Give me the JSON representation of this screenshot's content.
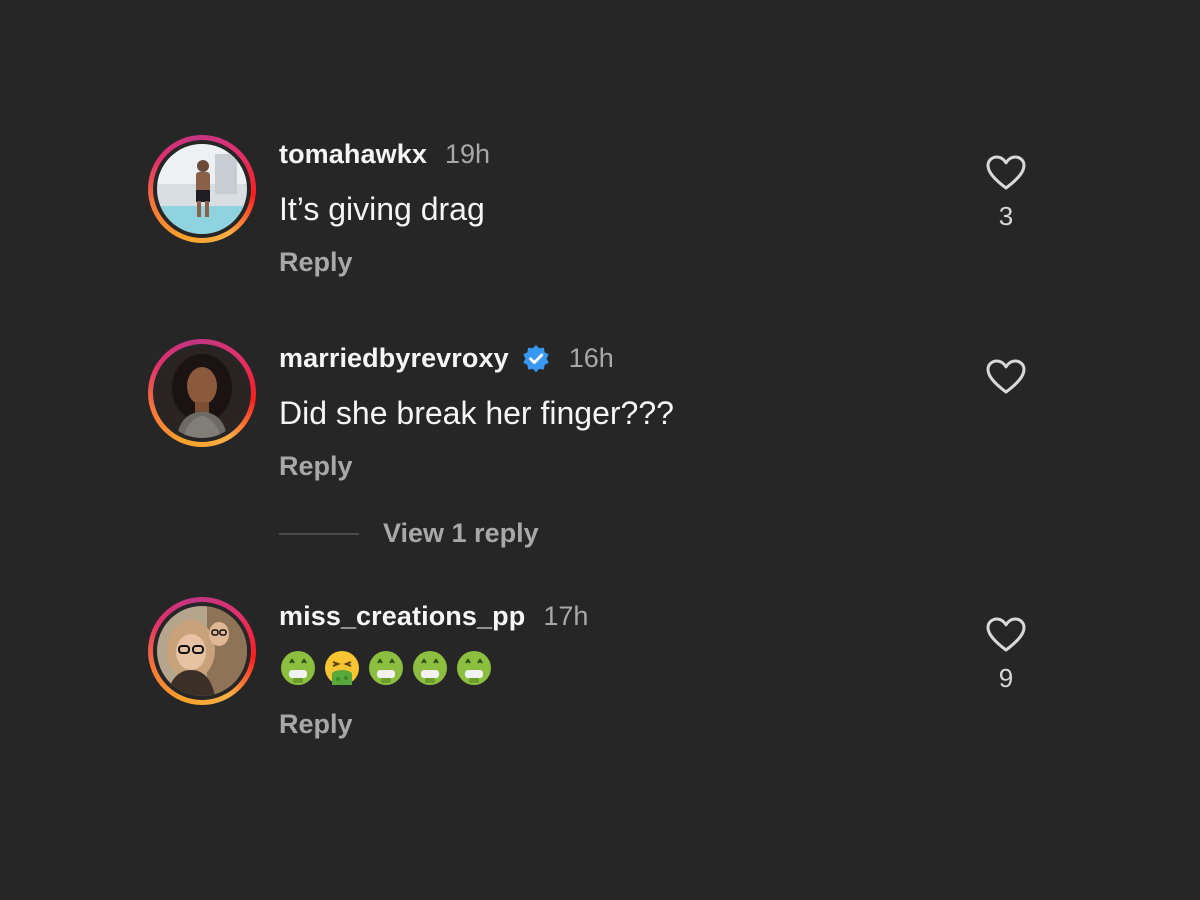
{
  "comments": [
    {
      "username": "tomahawkx",
      "verified": false,
      "time": "19h",
      "text": "It’s giving drag",
      "reply_label": "Reply",
      "like_count": "3",
      "avatar": "profile-photo"
    },
    {
      "username": "marriedbyrevroxy",
      "verified": true,
      "time": "16h",
      "text": "Did she break her finger???",
      "reply_label": "Reply",
      "like_count": "",
      "avatar": "profile-photo"
    },
    {
      "username": "miss_creations_pp",
      "verified": false,
      "time": "17h",
      "emojis": [
        "🤑",
        "🤮",
        "🤑",
        "🤑",
        "🤑"
      ],
      "reply_label": "Reply",
      "like_count": "9",
      "avatar": "profile-photo"
    }
  ],
  "view_replies": {
    "label": "View 1 reply"
  },
  "icons": {
    "like": "heart-outline-icon",
    "verified": "verified-badge-icon"
  },
  "colors": {
    "background": "#262626",
    "verified_blue": "#3897f0",
    "secondary_text": "#a8a8a8"
  }
}
